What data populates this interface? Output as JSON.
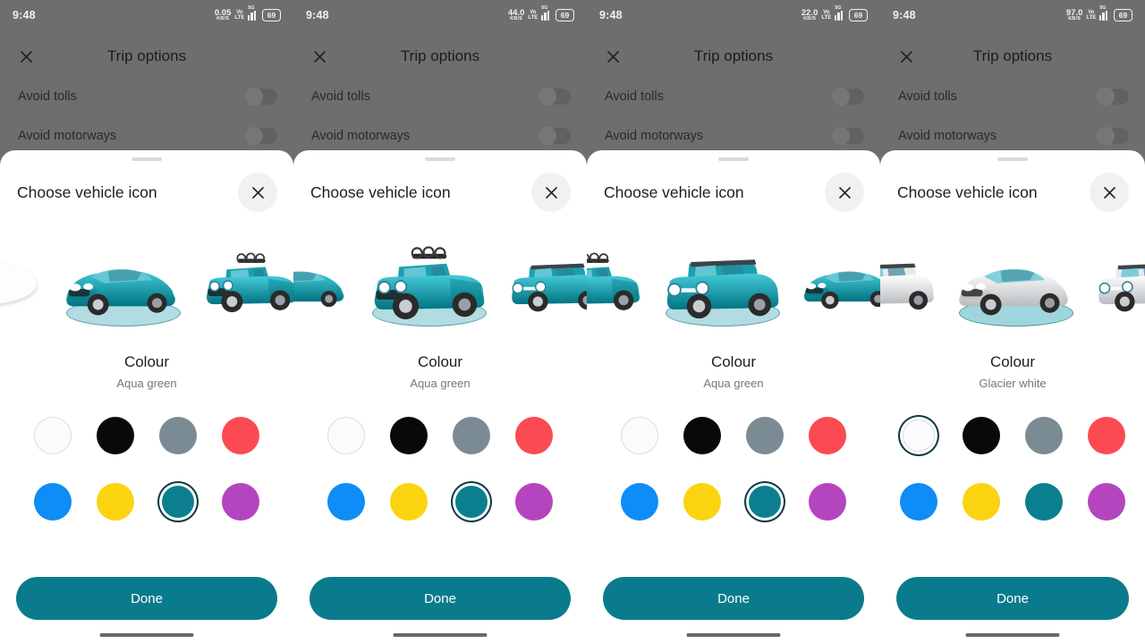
{
  "meta": {
    "accent_teal": "#0a7b8c",
    "scrim": "#6e6e6e",
    "sheet_bg": "#ffffff"
  },
  "palette": [
    {
      "name": "glacier-white",
      "label": "Glacier white",
      "hex": "#fafbfd",
      "light": true
    },
    {
      "name": "black",
      "label": "Black",
      "hex": "#090909",
      "light": false
    },
    {
      "name": "slate-grey",
      "label": "Slate grey",
      "hex": "#7b8b93",
      "light": false
    },
    {
      "name": "red",
      "label": "Red",
      "hex": "#fb4a52",
      "light": false
    },
    {
      "name": "blue",
      "label": "Blue",
      "hex": "#0d8df5",
      "light": false
    },
    {
      "name": "yellow",
      "label": "Yellow",
      "hex": "#fbd310",
      "light": false
    },
    {
      "name": "aqua-green",
      "label": "Aqua green",
      "hex": "#0b7f8f",
      "light": false
    },
    {
      "name": "purple",
      "label": "Purple",
      "hex": "#b545be",
      "light": false
    }
  ],
  "panels": [
    {
      "status": {
        "time": "9:48",
        "net_rate": "0.05",
        "net_unit": "KB/S",
        "volte_top": "Vo",
        "volte_bottom": "LTE",
        "network_gen": "5G",
        "battery": "69"
      },
      "background": {
        "close_icon": "close-icon",
        "title": "Trip options",
        "rows": [
          {
            "label": "Avoid tolls",
            "toggle": "off"
          },
          {
            "label": "Avoid motorways",
            "toggle": "off"
          }
        ]
      },
      "sheet": {
        "title": "Choose vehicle icon",
        "close_icon": "close-icon",
        "colour_heading": "Colour",
        "colour_value": "Aqua green",
        "selected_colour_index": 6,
        "done_label": "Done",
        "carousel": {
          "offset": -72,
          "items": [
            {
              "name": "navigation-arrow-icon",
              "type": "arrow",
              "colour": "#3b62e0",
              "selected": false
            },
            {
              "name": "vehicle-sports-car",
              "type": "sports",
              "colour": "#1aa0ae",
              "selected": true
            },
            {
              "name": "vehicle-pickup-truck",
              "type": "pickup",
              "colour": "#1aa0ae",
              "selected": false
            }
          ]
        }
      }
    },
    {
      "status": {
        "time": "9:48",
        "net_rate": "44.0",
        "net_unit": "KB/S",
        "volte_top": "Vo",
        "volte_bottom": "LTE",
        "network_gen": "5G",
        "battery": "69"
      },
      "background": {
        "close_icon": "close-icon",
        "title": "Trip options",
        "rows": [
          {
            "label": "Avoid tolls",
            "toggle": "off"
          },
          {
            "label": "Avoid motorways",
            "toggle": "off"
          }
        ]
      },
      "sheet": {
        "title": "Choose vehicle icon",
        "close_icon": "close-icon",
        "colour_heading": "Colour",
        "colour_value": "Aqua green",
        "selected_colour_index": 6,
        "done_label": "Done",
        "carousel": {
          "offset": -58,
          "items": [
            {
              "name": "vehicle-sports-car",
              "type": "sports",
              "colour": "#1aa0ae",
              "selected": false
            },
            {
              "name": "vehicle-pickup-truck",
              "type": "pickup",
              "colour": "#1aa0ae",
              "selected": true
            },
            {
              "name": "vehicle-suv",
              "type": "suv",
              "colour": "#1aa0ae",
              "selected": false
            }
          ]
        }
      }
    },
    {
      "status": {
        "time": "9:48",
        "net_rate": "22.0",
        "net_unit": "KB/S",
        "volte_top": "Vo",
        "volte_bottom": "LTE",
        "network_gen": "5G",
        "battery": "69"
      },
      "background": {
        "close_icon": "close-icon",
        "title": "Trip options",
        "rows": [
          {
            "label": "Avoid tolls",
            "toggle": "off"
          },
          {
            "label": "Avoid motorways",
            "toggle": "off"
          }
        ]
      },
      "sheet": {
        "title": "Choose vehicle icon",
        "close_icon": "close-icon",
        "colour_heading": "Colour",
        "colour_value": "Aqua green",
        "selected_colour_index": 6,
        "done_label": "Done",
        "carousel": {
          "offset": -58,
          "items": [
            {
              "name": "vehicle-pickup-truck",
              "type": "pickup",
              "colour": "#1aa0ae",
              "selected": false
            },
            {
              "name": "vehicle-suv",
              "type": "suv",
              "colour": "#1aa0ae",
              "selected": true
            },
            {
              "name": "vehicle-sports-car",
              "type": "sports",
              "colour": "#1aa0ae",
              "selected": false
            }
          ]
        }
      }
    },
    {
      "status": {
        "time": "9:48",
        "net_rate": "97.0",
        "net_unit": "KB/S",
        "volte_top": "Vo",
        "volte_bottom": "LTE",
        "network_gen": "5G",
        "battery": "69"
      },
      "background": {
        "close_icon": "close-icon",
        "title": "Trip options",
        "rows": [
          {
            "label": "Avoid tolls",
            "toggle": "off"
          },
          {
            "label": "Avoid motorways",
            "toggle": "off"
          }
        ]
      },
      "sheet": {
        "title": "Choose vehicle icon",
        "close_icon": "close-icon",
        "colour_heading": "Colour",
        "colour_value": "Glacier white",
        "selected_colour_index": 0,
        "done_label": "Done",
        "carousel": {
          "offset": -58,
          "items": [
            {
              "name": "vehicle-suv",
              "type": "suv",
              "colour": "#e6e9ec",
              "selected": false
            },
            {
              "name": "vehicle-sports-car",
              "type": "sports",
              "colour": "#e6e9ec",
              "selected": true
            },
            {
              "name": "vehicle-hatchback",
              "type": "suv",
              "colour": "#e6e9ec",
              "selected": false
            }
          ]
        }
      }
    }
  ]
}
